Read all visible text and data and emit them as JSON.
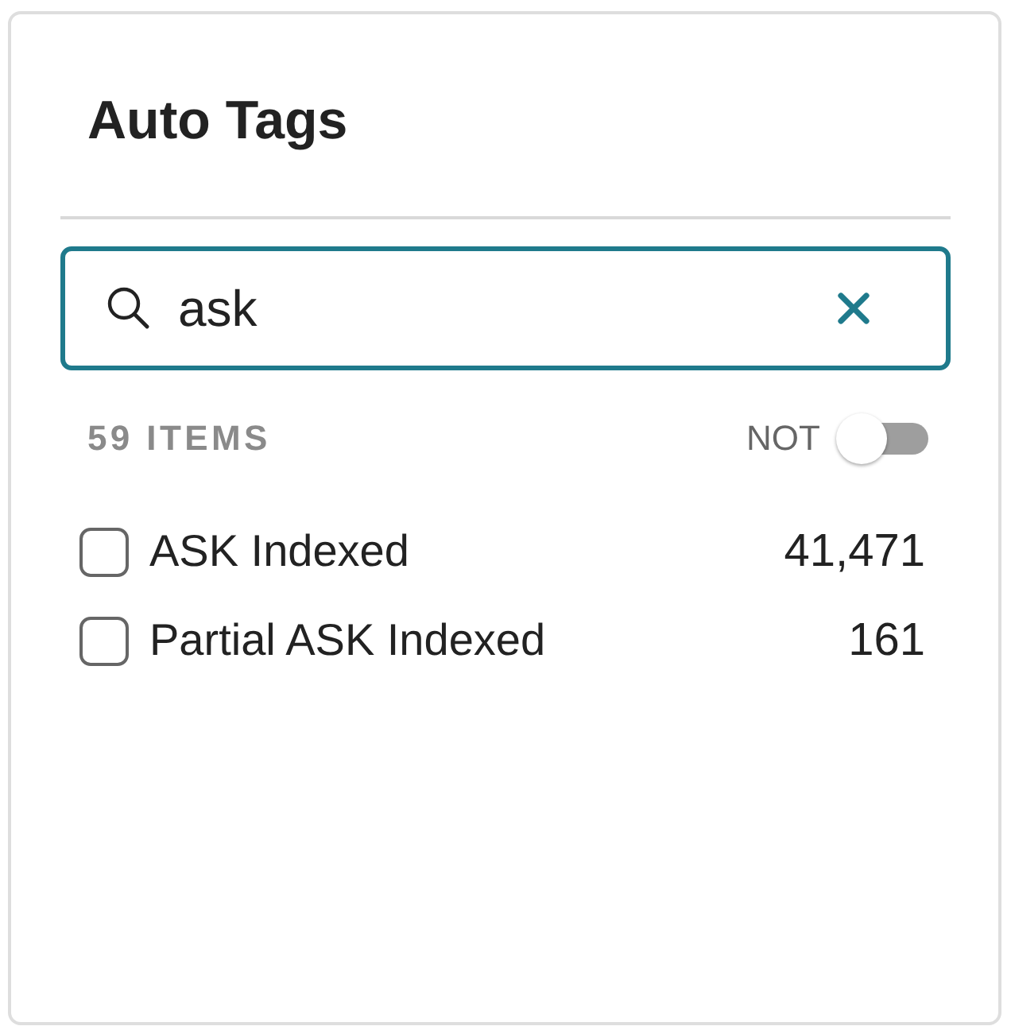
{
  "panel": {
    "title": "Auto Tags"
  },
  "search": {
    "value": "ask"
  },
  "filter_bar": {
    "count": "59 ITEMS",
    "not_toggle": {
      "label": "NOT",
      "on": false
    }
  },
  "items": [
    {
      "label": "ASK Indexed",
      "count": "41,471",
      "checked": false
    },
    {
      "label": "Partial ASK Indexed",
      "count": "161",
      "checked": false
    }
  ]
}
